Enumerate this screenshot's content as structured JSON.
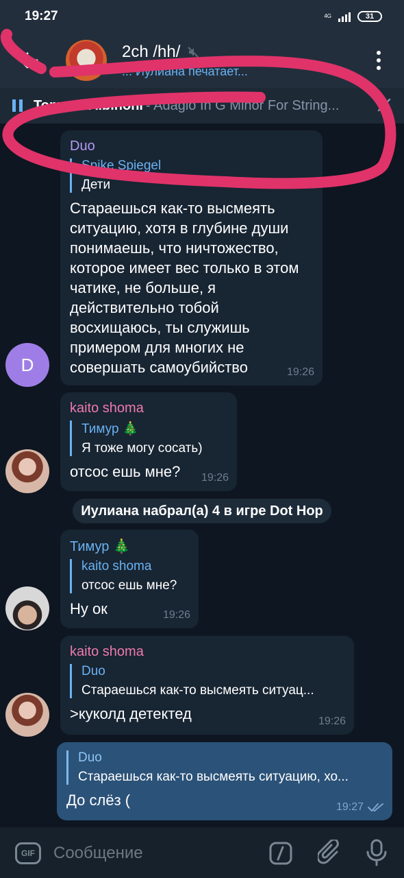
{
  "status": {
    "time": "19:27",
    "network": "4G",
    "battery": "31"
  },
  "header": {
    "title": "2ch /hh/",
    "subtitle": "... Иулиана печатает...",
    "colors": {
      "bar": "#232e3c",
      "accent": "#6ab2f2"
    }
  },
  "player": {
    "artist": "Tomaso Albinoni",
    "song": " - Adagio In G Minor For String..."
  },
  "messages": [
    {
      "sender": "Duo",
      "sender_color": "#b49af3",
      "reply_name": "Spike Spiegel",
      "reply_text": "Дети",
      "text": "Стараешься как-то высмеять ситуацию, хотя в глубине души понимаешь, что ничтожество, которое имеет вес только в этом чатике, не больше, я действительно тобой восхищаюсь, ты служишь примером для многих не совершать самоубийство",
      "time": "19:26",
      "avatar_letter": "D"
    },
    {
      "sender": "kaito shoma",
      "sender_color": "#ee7aae",
      "reply_name": "Тимур 🎄",
      "reply_text": "Я тоже могу сосать)",
      "text": "отсос ешь мне?",
      "time": "19:26"
    },
    {
      "sender": "Тимур 🎄",
      "sender_color": "#6ab2f2",
      "reply_name": "kaito shoma",
      "reply_text": "отсос ешь мне?",
      "text": "Ну ок",
      "time": "19:26"
    },
    {
      "sender": "kaito shoma",
      "sender_color": "#ee7aae",
      "reply_name": "Duo",
      "reply_text": "Стараешься как-то высмеять ситуац...",
      "text": ">куколд детектед",
      "time": "19:26"
    },
    {
      "reply_name": "Duo",
      "reply_text": "Стараешься как-то высмеять ситуацию, хо...",
      "text": "До слёз (",
      "time": "19:27"
    }
  ],
  "service_message": "Иулиана набрал(а) 4 в игре Dot Hop",
  "input": {
    "placeholder": "Сообщение",
    "gif_label": "GIF"
  }
}
